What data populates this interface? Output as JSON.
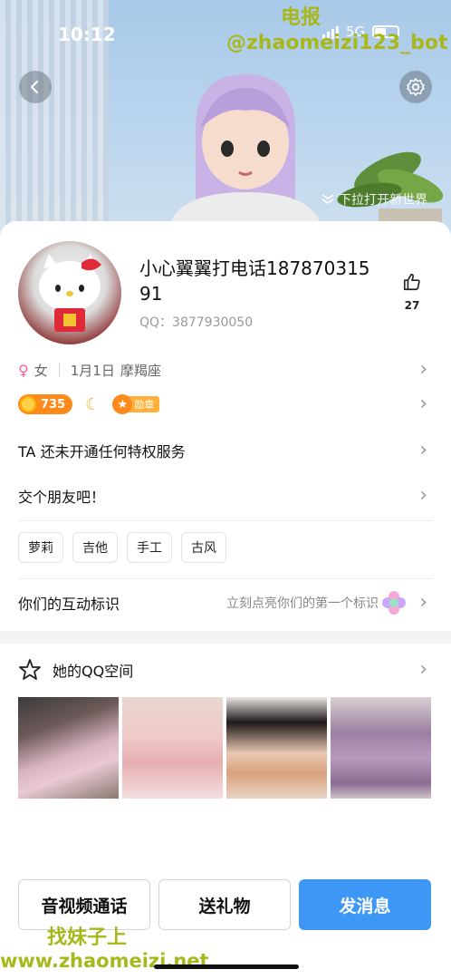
{
  "status_bar": {
    "time": "10:12",
    "network": "5G"
  },
  "header": {
    "pull_hint": "下拉打开新世界"
  },
  "watermark": {
    "top_line1": "电报",
    "top_line2": "@zhaomeizi123_bot",
    "bottom_line1": "找妹子上",
    "bottom_line2": "www.zhaomeizi.net"
  },
  "profile": {
    "nickname": "小心翼翼打电话18787031591",
    "qq_label": "QQ：3877930050",
    "likes": "27",
    "gender": "女",
    "birthday": "1月1日",
    "zodiac": "摩羯座",
    "level": "735",
    "medal_label": "勋章"
  },
  "rows": {
    "privilege": "TA 还未开通任何特权服务",
    "friend": "交个朋友吧！",
    "interaction_title": "你们的互动标识",
    "interaction_hint": "立刻点亮你们的第一个标识",
    "qzone_title": "她的QQ空间"
  },
  "tags": [
    "萝莉",
    "吉他",
    "手工",
    "古风"
  ],
  "actions": {
    "call": "音视频通话",
    "gift": "送礼物",
    "message": "发消息"
  },
  "colors": {
    "accent": "#3f97f5",
    "watermark": "#a8b81c",
    "level_badge": "#ff8a1c"
  }
}
